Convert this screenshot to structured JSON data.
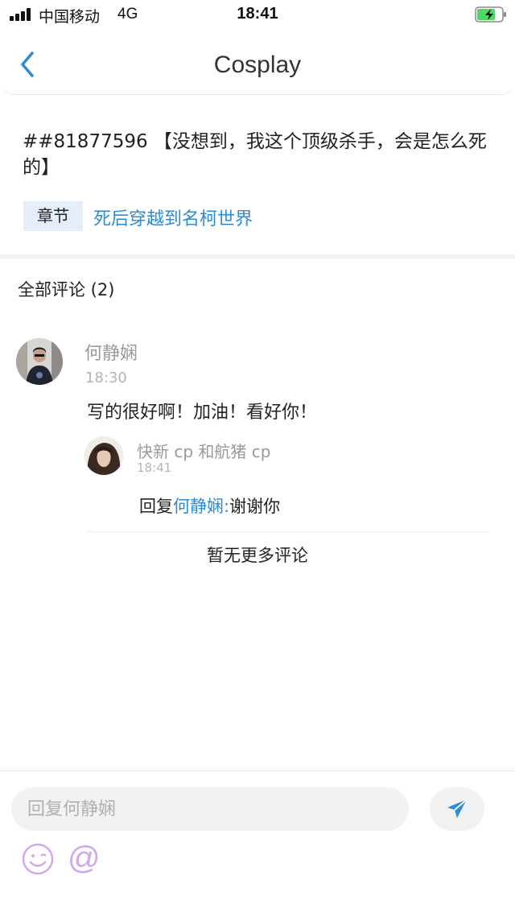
{
  "status_bar": {
    "carrier": "中国移动",
    "network": "4G",
    "time": "18:41"
  },
  "nav": {
    "title": "Cosplay"
  },
  "post": {
    "title": "##81877596 【没想到，我这个顶级杀手，会是怎么死的】",
    "chapter_tag": "章节",
    "chapter_link": "死后穿越到名柯世界"
  },
  "comments": {
    "heading": "全部评论 (2)",
    "main": {
      "author": "何静娴",
      "time": "18:30",
      "body": "写的很好啊！加油！看好你！"
    },
    "reply": {
      "author": "快新 cp 和航猪 cp",
      "time": "18:41",
      "prefix": "回复",
      "mention": "何静娴",
      "separator": ":",
      "body": "谢谢你"
    },
    "no_more": "暂无更多评论"
  },
  "composer": {
    "placeholder": "回复何静娴",
    "at_label": "@"
  },
  "icons": {
    "back": "chevron-left-icon",
    "send": "paper-plane-icon",
    "emoji": "smiley-icon",
    "battery": "battery-charging-icon"
  },
  "colors": {
    "accent": "#2a8cd6",
    "tag_bg": "#e3eef8",
    "emoji_purple": "#cfa8ee",
    "battery_green": "#4cd964"
  }
}
